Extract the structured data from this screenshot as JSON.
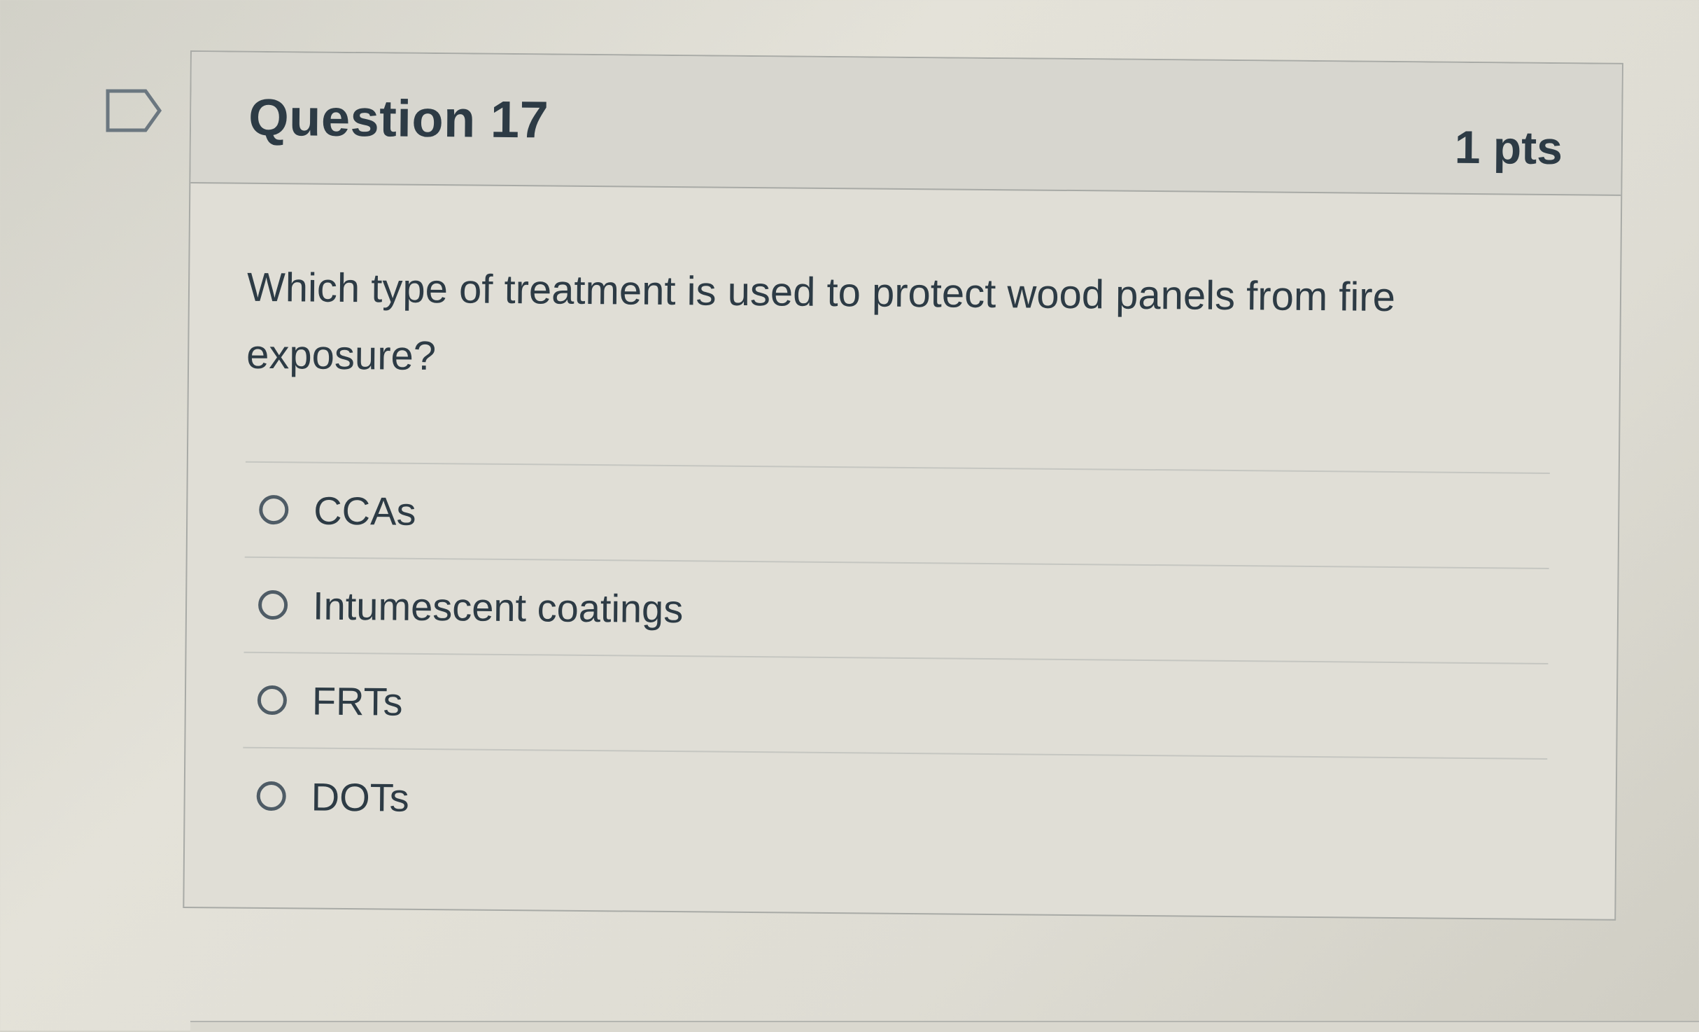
{
  "question": {
    "title": "Question 17",
    "points": "1 pts",
    "text": "Which type of treatment is used to protect wood panels from fire exposure?",
    "flag_icon": "flag-icon"
  },
  "answers": [
    {
      "label": "CCAs",
      "selected": false
    },
    {
      "label": "Intumescent coatings",
      "selected": false
    },
    {
      "label": "FRTs",
      "selected": false
    },
    {
      "label": "DOTs",
      "selected": false
    }
  ],
  "colors": {
    "text": "#2d3b45",
    "border": "#a8aaa6",
    "header_bg": "#d7d6cf"
  }
}
